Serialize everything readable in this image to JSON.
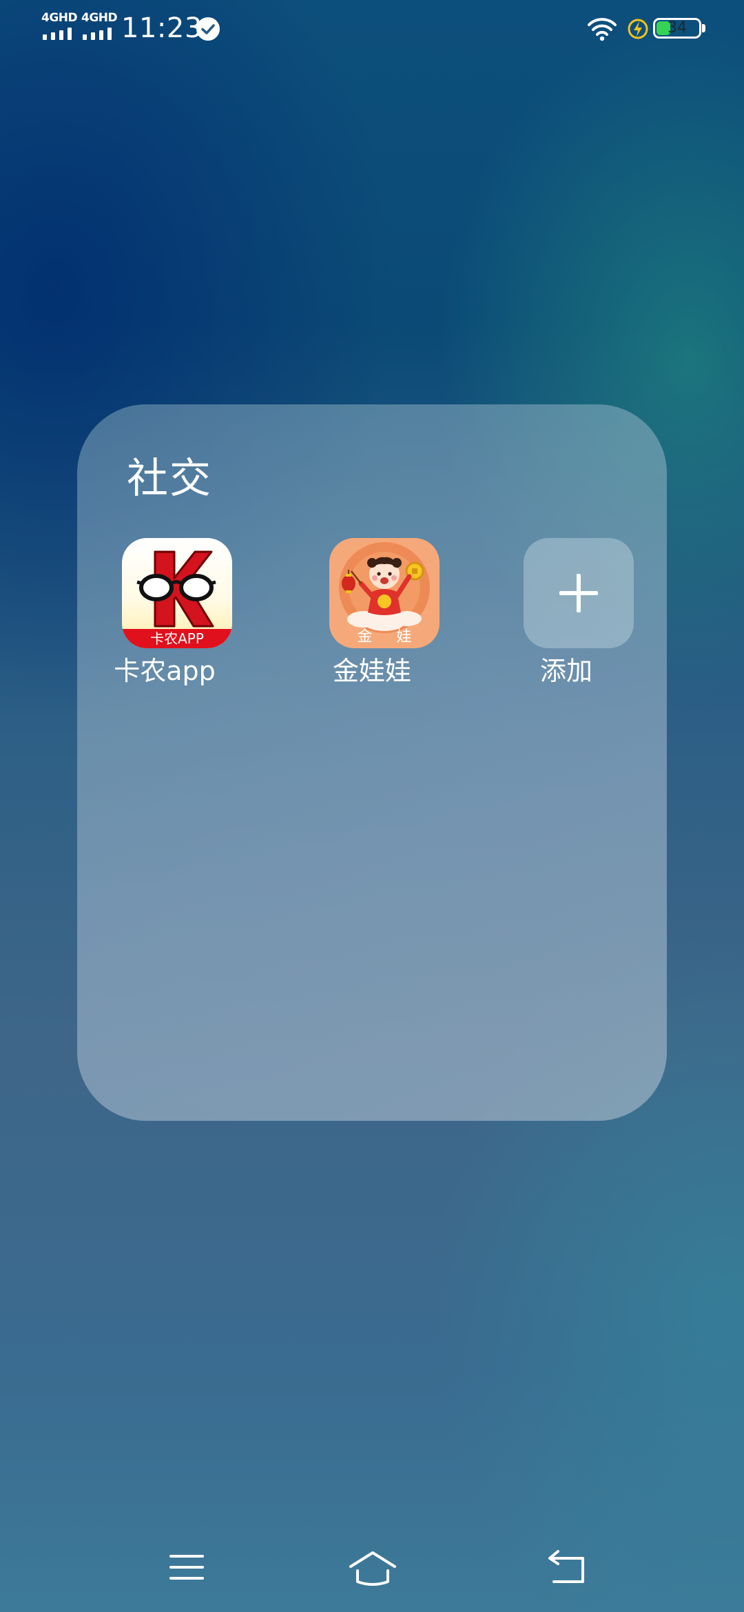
{
  "status_bar": {
    "signal_1_label": "4GHD",
    "signal_2_label": "4GHD",
    "time": "11:23",
    "battery_level": "34",
    "battery_percent": 34,
    "icons": [
      "signal-icon",
      "verified-check-icon",
      "wifi-icon",
      "charging-icon",
      "battery-icon"
    ]
  },
  "folder": {
    "title": "社交",
    "apps": [
      {
        "label": "卡农app",
        "icon": "kanong-app-icon",
        "icon_text": "卡农APP"
      },
      {
        "label": "金娃娃",
        "icon": "jinwawa-app-icon",
        "icon_text": "金 娃 娃"
      },
      {
        "label": "添加",
        "icon": "plus-icon"
      }
    ]
  },
  "nav_bar": {
    "icons": [
      "menu-icon",
      "home-icon",
      "back-icon"
    ]
  },
  "colors": {
    "battery_fill": "#36d455",
    "kanong_red": "#e0101c",
    "jinwawa_orange": "#f5a97a"
  }
}
